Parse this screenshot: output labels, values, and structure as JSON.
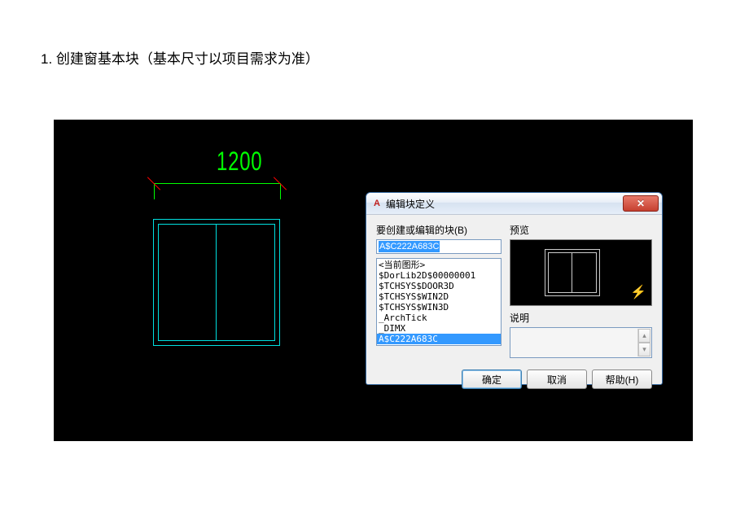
{
  "page": {
    "title": "1. 创建窗基本块（基本尺寸以项目需求为准）"
  },
  "cad": {
    "dimension_value": "1200"
  },
  "dialog": {
    "title": "编辑块定义",
    "close_glyph": "✕",
    "left_label": "要创建或编辑的块(B)",
    "block_name_value": "A$C222A683C",
    "list_items": [
      "<当前图形>",
      "$DorLib2D$00000001",
      "$TCHSYS$DOOR3D",
      "$TCHSYS$WIN2D",
      "$TCHSYS$WIN3D",
      "_ArchTick",
      "_DIMX",
      "A$C222A683C"
    ],
    "selected_index": 7,
    "preview_label": "预览",
    "desc_label": "说明",
    "bolt_glyph": "⚡",
    "buttons": {
      "ok": "确定",
      "cancel": "取消",
      "help": "帮助(H)"
    }
  }
}
